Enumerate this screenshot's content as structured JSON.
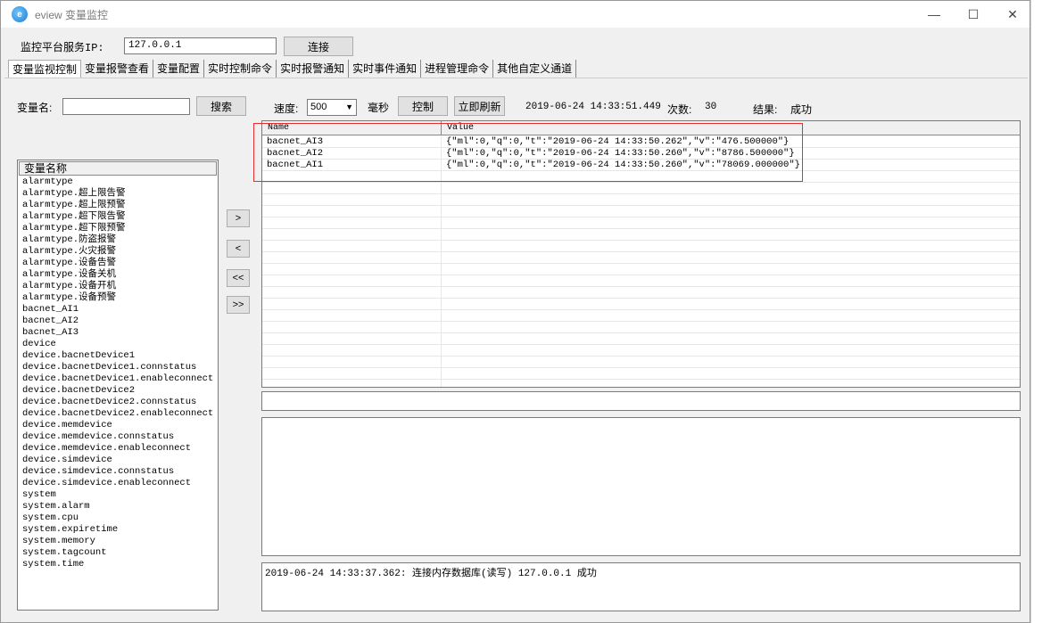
{
  "window": {
    "app_icon_text": "e",
    "title": "eview 变量监控",
    "minimize": "—",
    "maximize": "☐",
    "close": "✕"
  },
  "connection": {
    "server_label": "监控平台服务IP:",
    "server_ip": "127.0.0.1",
    "connect_button": "连接"
  },
  "tabs": [
    {
      "label": "变量监视控制",
      "active": true
    },
    {
      "label": "变量报警查看",
      "active": false
    },
    {
      "label": "变量配置",
      "active": false
    },
    {
      "label": "实时控制命令",
      "active": false
    },
    {
      "label": "实时报警通知",
      "active": false
    },
    {
      "label": "实时事件通知",
      "active": false
    },
    {
      "label": "进程管理命令",
      "active": false
    },
    {
      "label": "其他自定义通道",
      "active": false
    }
  ],
  "search": {
    "label": "变量名:",
    "value": "",
    "button": "搜索"
  },
  "controls": {
    "speed_label": "速度:",
    "speed_value": "500",
    "unit": "毫秒",
    "control_button": "控制",
    "refresh_button": "立即刷新",
    "timestamp": "2019-06-24 14:33:51.449",
    "count_label": "次数:",
    "count_value": "30",
    "result_label": "结果:",
    "result_value": "成功"
  },
  "variable_list": {
    "header": "变量名称",
    "items": [
      "alarmtype",
      "alarmtype.超上限告警",
      "alarmtype.超上限预警",
      "alarmtype.超下限告警",
      "alarmtype.超下限预警",
      "alarmtype.防盗报警",
      "alarmtype.火灾报警",
      "alarmtype.设备告警",
      "alarmtype.设备关机",
      "alarmtype.设备开机",
      "alarmtype.设备预警",
      "bacnet_AI1",
      "bacnet_AI2",
      "bacnet_AI3",
      "device",
      "device.bacnetDevice1",
      "device.bacnetDevice1.connstatus",
      "device.bacnetDevice1.enableconnect",
      "device.bacnetDevice2",
      "device.bacnetDevice2.connstatus",
      "device.bacnetDevice2.enableconnect",
      "device.memdevice",
      "device.memdevice.connstatus",
      "device.memdevice.enableconnect",
      "device.simdevice",
      "device.simdevice.connstatus",
      "device.simdevice.enableconnect",
      "system",
      "system.alarm",
      "system.cpu",
      "system.expiretime",
      "system.memory",
      "system.tagcount",
      "system.time"
    ]
  },
  "transfer_buttons": {
    "add": ">",
    "remove": "<",
    "remove_all": "<<",
    "add_all": ">>"
  },
  "monitor_table": {
    "columns": [
      "Name",
      "Value"
    ],
    "rows": [
      {
        "name": "bacnet_AI3",
        "value": "{\"ml\":0,\"q\":0,\"t\":\"2019-06-24 14:33:50.262\",\"v\":\"476.500000\"}"
      },
      {
        "name": "bacnet_AI2",
        "value": "{\"ml\":0,\"q\":0,\"t\":\"2019-06-24 14:33:50.260\",\"v\":\"8786.500000\"}"
      },
      {
        "name": "bacnet_AI1",
        "value": "{\"ml\":0,\"q\":0,\"t\":\"2019-06-24 14:33:50.260\",\"v\":\"78069.000000\"}"
      }
    ]
  },
  "log": {
    "message": "2019-06-24 14:33:37.362: 连接内存数据库(读写) 127.0.0.1 成功"
  }
}
